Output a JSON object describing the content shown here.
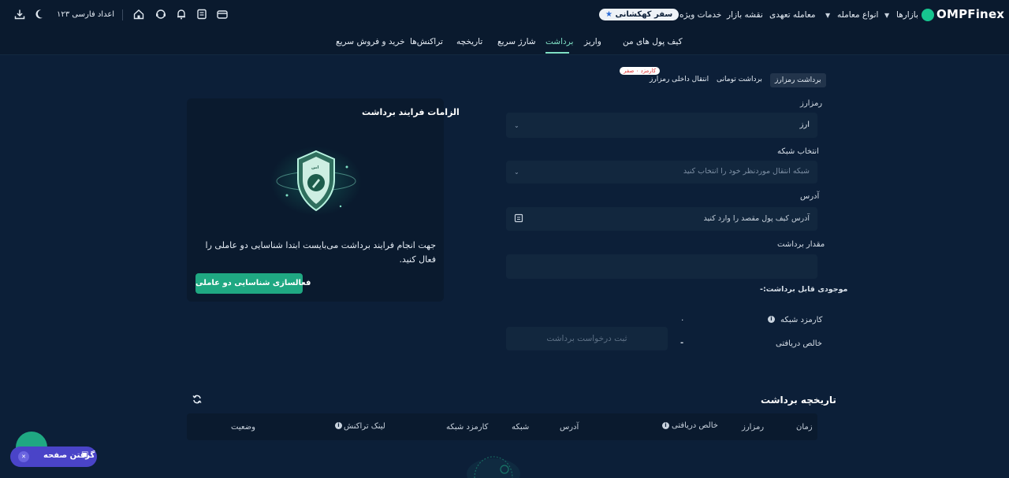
{
  "topbar": {
    "logo": "OMPFinex",
    "nav": [
      "بازارها",
      "انواع معامله",
      "معامله تعهدی",
      "نقشه بازار",
      "خدمات ویژه"
    ],
    "badge": "سفر کهکشانی",
    "digits_label": "اعداد فارسی ۱۲۳"
  },
  "subnav": {
    "tabs": [
      "کیف پول های من",
      "واریز",
      "برداشت",
      "شارژ سریع",
      "تاریخچه",
      "تراکنش‌ها",
      "خرید و فروش سریع"
    ]
  },
  "withdraw_tabs": {
    "crypto": "برداشت رمزارز",
    "toman": "برداشت تومانی",
    "internal": "انتقال داخلی رمزارز",
    "fee_badge": "کارمزد ۰ صفر"
  },
  "form": {
    "crypto_label": "رمزارز",
    "crypto_value": "ارز",
    "network_label": "انتخاب شبکه",
    "network_placeholder": "شبکه انتقال موردنظر خود را انتخاب کنید",
    "address_label": "آدرس",
    "address_placeholder": "آدرس کیف پول مقصد را وارد کنید",
    "amount_label": "مقدار برداشت",
    "available_label": "موجودی قابل برداشت:",
    "available_value": "-",
    "network_fee_label": "کارمزد شبکه",
    "network_fee_value": "۰",
    "net_label": "خالص دریافتی",
    "net_value": "-",
    "submit": "ثبت درخواست برداشت"
  },
  "requirements": {
    "title": "الزامات فرایند برداشت",
    "text": "جهت انجام فرایند برداشت می‌بایست ابتدا شناسایی دو عاملی را فعال کنید.",
    "button": "فعالسازی شناسایی دو عاملی",
    "shield_mark": "امن"
  },
  "history": {
    "title": "تاریخچه برداشت",
    "columns": [
      "زمان",
      "رمزارز",
      "خالص دریافتی",
      "آدرس",
      "شبکه",
      "کارمزد شبکه",
      "لینک تراکنش",
      "وضعیت"
    ]
  },
  "float_button": {
    "label": "گرفتن صفحه"
  },
  "colors": {
    "bg": "#0c1f38",
    "topbar": "#0a1a2e",
    "accent": "#1fa882",
    "active_tab": "#7fe0c4"
  }
}
